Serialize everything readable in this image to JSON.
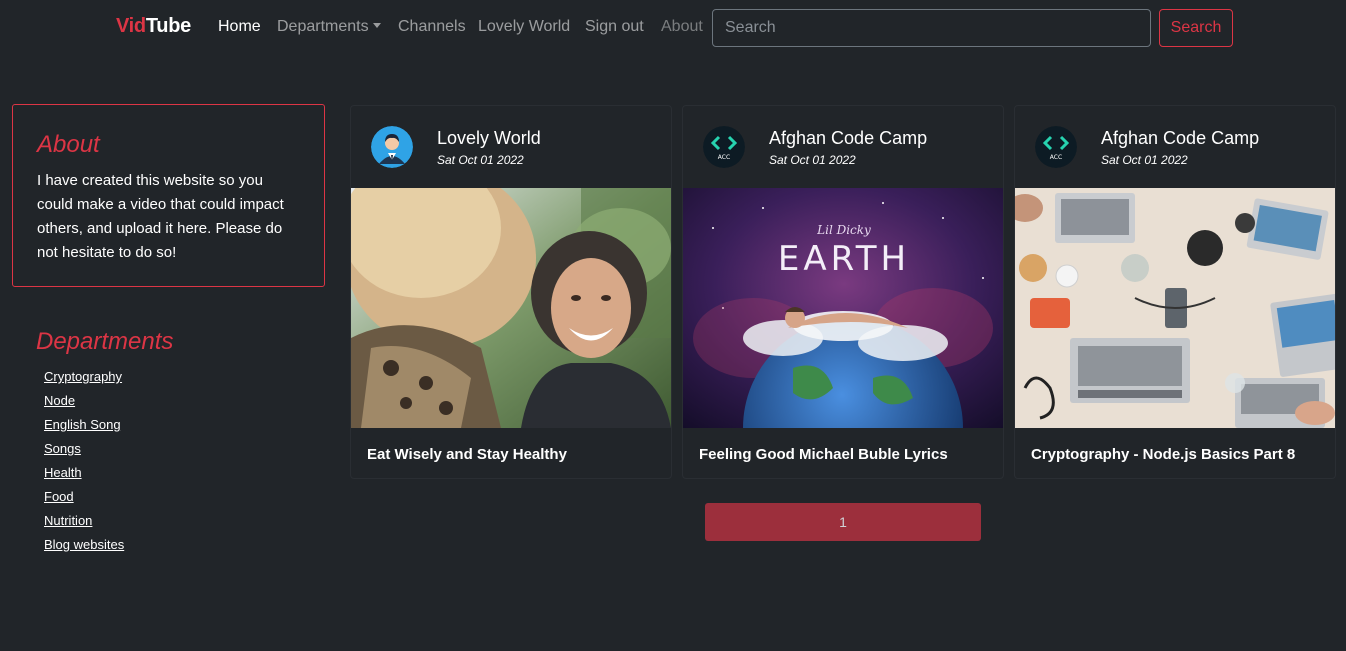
{
  "brand": {
    "part1": "Vid",
    "part2": "Tube"
  },
  "nav": {
    "home": "Home",
    "departments": "Departments",
    "channels": "Channels",
    "lovely_world": "Lovely World",
    "sign_out": "Sign out",
    "about": "About"
  },
  "search": {
    "placeholder": "Search",
    "button": "Search"
  },
  "sidebar": {
    "about_title": "About",
    "about_text": "I have created this website so you could make a video that could impact others, and upload it here. Please do not hesitate to do so!",
    "departments_title": "Departments",
    "departments": [
      "Cryptography",
      "Node",
      "English Song",
      "Songs",
      "Health",
      "Food",
      "Nutrition",
      "Blog websites"
    ]
  },
  "videos": [
    {
      "channel": "Lovely World",
      "date": "Sat Oct 01 2022",
      "title": "Eat Wisely and Stay Healthy",
      "avatar_icon": "user-avatar-icon",
      "thumb": "two smiling women outdoors"
    },
    {
      "channel": "Afghan Code Camp",
      "date": "Sat Oct 01 2022",
      "title": "Feeling Good Michael Buble Lyrics",
      "avatar_icon": "acc-logo-icon",
      "thumb_text_script": "Lil Dicky",
      "thumb_text_big": "EARTH"
    },
    {
      "channel": "Afghan Code Camp",
      "date": "Sat Oct 01 2022",
      "title": "Cryptography - Node.js Basics Part 8",
      "avatar_icon": "acc-logo-icon",
      "thumb": "laptops on a table"
    }
  ],
  "acc_logo_text": "ACC",
  "pagination": {
    "current": "1"
  },
  "colors": {
    "accent": "#dc3545",
    "background": "#212529",
    "page_button": "#9c2f3c"
  }
}
